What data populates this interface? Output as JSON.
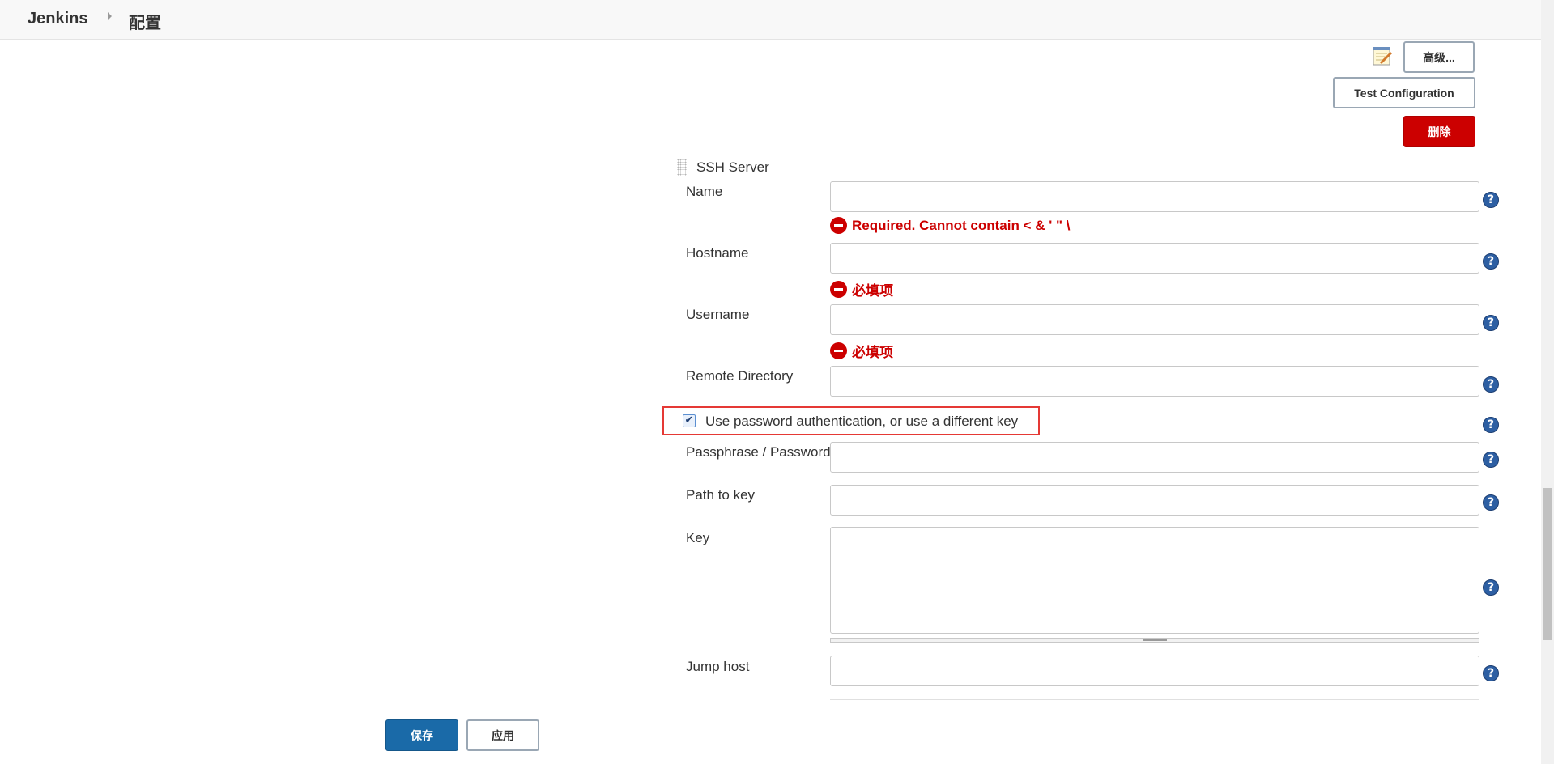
{
  "header": {
    "brand": "Jenkins",
    "breadcrumb": "配置"
  },
  "top_actions": {
    "advanced_label": "高级...",
    "test_config_label": "Test Configuration",
    "delete_label": "删除"
  },
  "ssh_server": {
    "title": "SSH Server",
    "name": {
      "label": "Name",
      "value": "",
      "error": "Required. Cannot contain < & ' \" \\"
    },
    "hostname": {
      "label": "Hostname",
      "value": "",
      "error": "必填项"
    },
    "username": {
      "label": "Username",
      "value": "",
      "error": "必填项"
    },
    "remote_directory": {
      "label": "Remote Directory",
      "value": ""
    },
    "use_password": {
      "label": "Use password authentication, or use a different key",
      "checked": true
    },
    "passphrase": {
      "label": "Passphrase / Password",
      "value": ""
    },
    "path_to_key": {
      "label": "Path to key",
      "value": ""
    },
    "key": {
      "label": "Key",
      "value": ""
    },
    "jump_host": {
      "label": "Jump host",
      "value": ""
    },
    "help_glyph": "?"
  },
  "footer": {
    "save_label": "保存",
    "apply_label": "应用"
  },
  "colors": {
    "error": "#cc0000",
    "delete_button": "#cc0000",
    "save_button": "#1a6aa8",
    "highlight": "#e53935"
  },
  "icons": [
    "notepad-icon",
    "help-icon",
    "error-icon",
    "drag-handle-icon",
    "checkmark-icon"
  ]
}
